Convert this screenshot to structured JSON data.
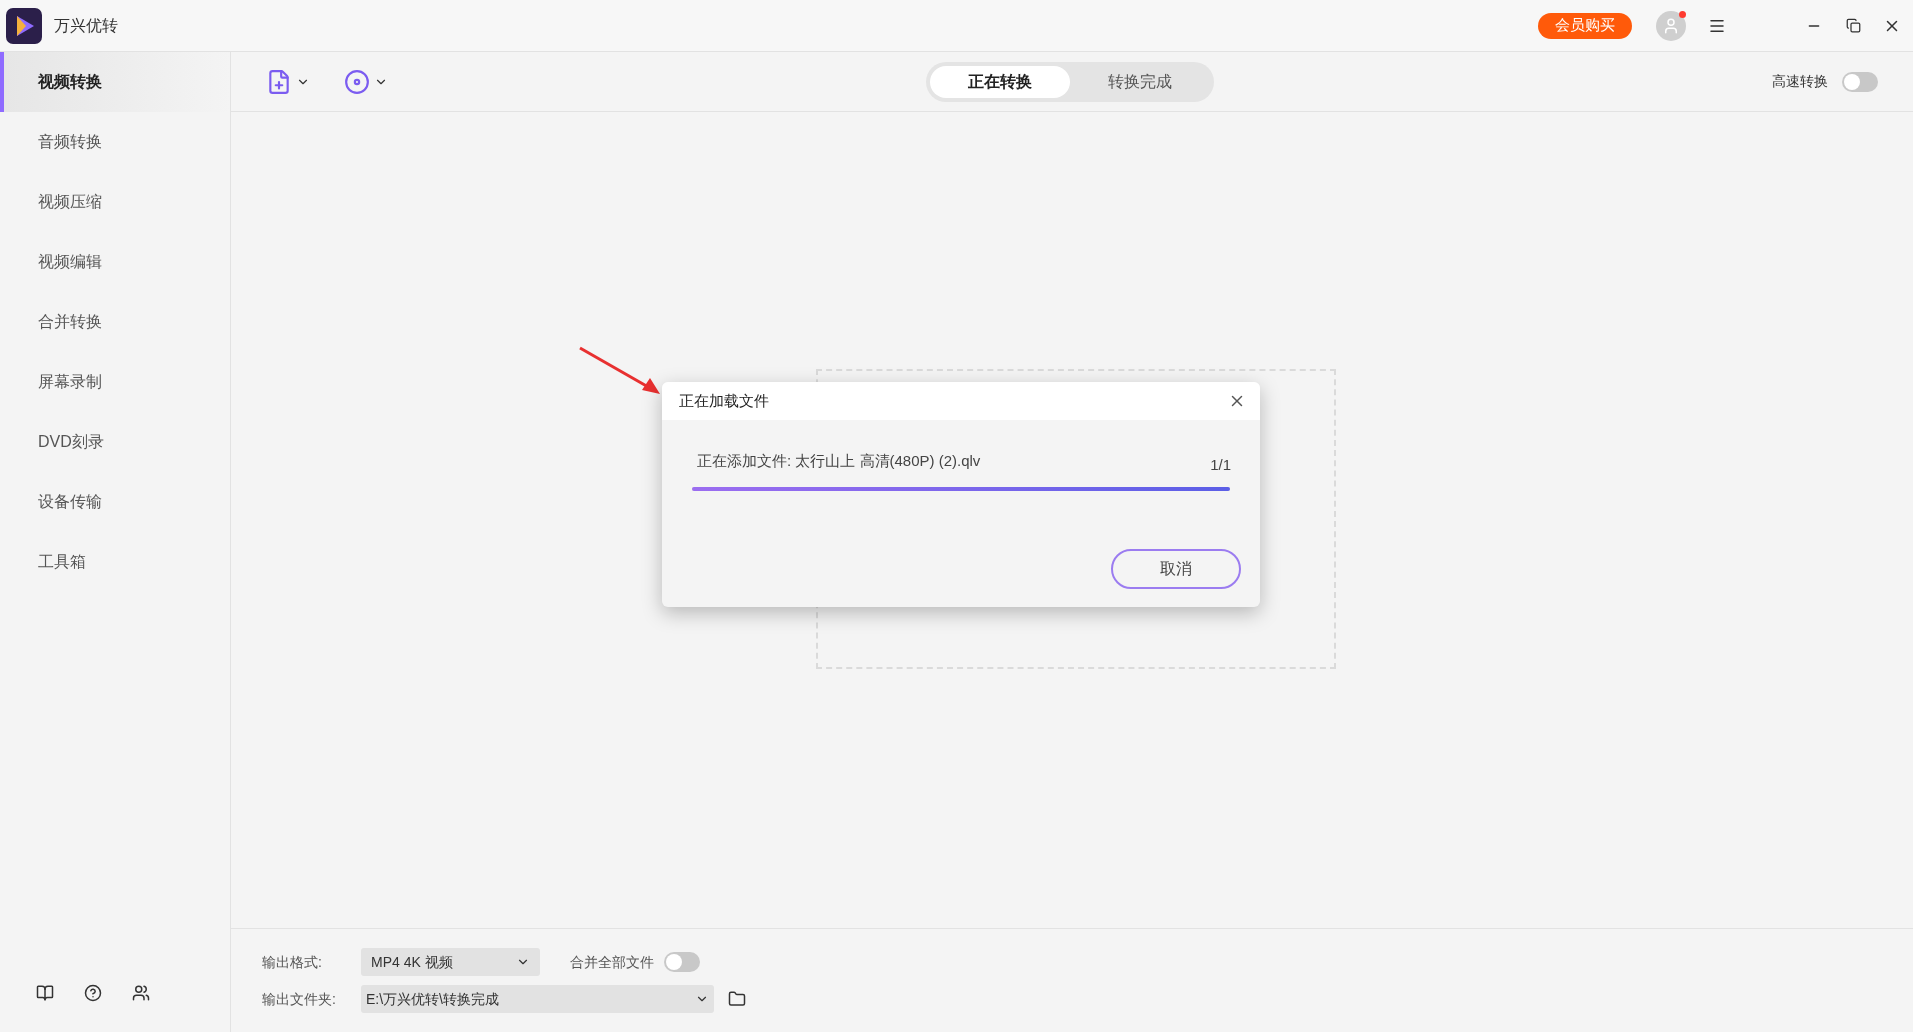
{
  "window": {
    "title": "万兴优转",
    "buy_button": "会员购买",
    "account_badge": true
  },
  "sidebar": {
    "items": [
      {
        "label": "视频转换",
        "selected": true
      },
      {
        "label": "音频转换",
        "selected": false
      },
      {
        "label": "视频压缩",
        "selected": false
      },
      {
        "label": "视频编辑",
        "selected": false
      },
      {
        "label": "合并转换",
        "selected": false
      },
      {
        "label": "屏幕录制",
        "selected": false
      },
      {
        "label": "DVD刻录",
        "selected": false
      },
      {
        "label": "设备传输",
        "selected": false
      },
      {
        "label": "工具箱",
        "selected": false
      }
    ]
  },
  "toolbar": {
    "tabs": [
      {
        "label": "正在转换",
        "selected": true
      },
      {
        "label": "转换完成",
        "selected": false
      }
    ],
    "high_speed": {
      "label": "高速转换",
      "on": false
    }
  },
  "dialog": {
    "title": "正在加载文件",
    "message": "正在添加文件: 太行山上 高清(480P) (2).qlv",
    "count": "1/1",
    "level": 1,
    "cancel": "取消"
  },
  "footer": {
    "format_label": "输出格式:",
    "format_value": "MP4 4K 视频",
    "merge": {
      "label": "合并全部文件",
      "on": false
    },
    "folder_label": "输出文件夹:",
    "folder_value": "E:\\万兴优转\\转换完成"
  }
}
